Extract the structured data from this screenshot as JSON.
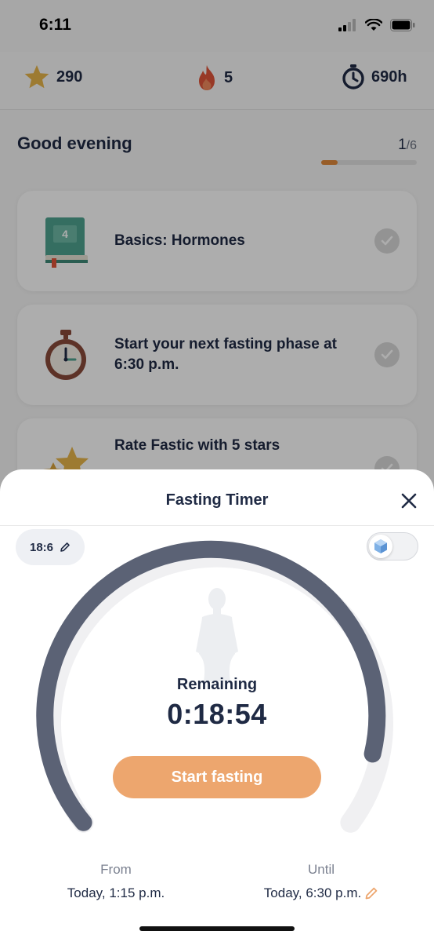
{
  "status_bar": {
    "time": "6:11"
  },
  "stats": {
    "points": "290",
    "streak": "5",
    "hours": "690h"
  },
  "home": {
    "greeting": "Good evening",
    "progress_done": "1",
    "progress_total": "/6",
    "progress_fraction": 0.17,
    "tasks": [
      {
        "label": "Basics: Hormones",
        "book_number": "4"
      },
      {
        "label": "Start your next fasting phase at 6:30 p.m."
      },
      {
        "label": "Rate Fastic with 5 stars"
      }
    ]
  },
  "sheet": {
    "title": "Fasting Timer",
    "plan_label": "18:6",
    "remaining_label": "Remaining",
    "remaining_value": "0:18:54",
    "start_button": "Start fasting",
    "from_label": "From",
    "from_value": "Today, 1:15 p.m.",
    "until_label": "Until",
    "until_value": "Today, 6:30 p.m."
  },
  "colors": {
    "accent": "#eda66e",
    "arc": "#5b6275",
    "text": "#1f2a44",
    "streak": "#e0553a",
    "star": "#e8b54a"
  },
  "icons": {
    "stat_points": "star-icon",
    "stat_streak": "flame-icon",
    "stat_hours": "stopwatch-icon",
    "close": "close-icon",
    "edit": "pencil-icon"
  }
}
